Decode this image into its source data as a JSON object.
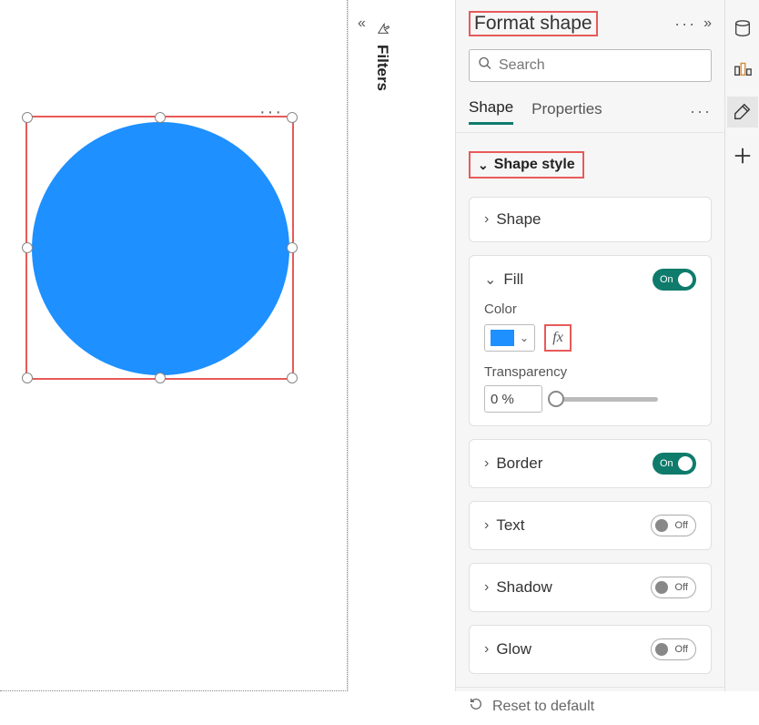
{
  "panel": {
    "title": "Format shape",
    "search_placeholder": "Search"
  },
  "filters": {
    "label": "Filters"
  },
  "tabs": {
    "shape": "Shape",
    "properties": "Properties"
  },
  "shape_style": {
    "label": "Shape style"
  },
  "cards": {
    "shape": "Shape",
    "fill": {
      "label": "Fill",
      "toggle": "On",
      "color_label": "Color",
      "color_value": "#1e90ff",
      "fx_label": "fx",
      "transparency_label": "Transparency",
      "transparency_value": "0 %"
    },
    "border": {
      "label": "Border",
      "toggle": "On"
    },
    "text": {
      "label": "Text",
      "toggle": "Off"
    },
    "shadow": {
      "label": "Shadow",
      "toggle": "Off"
    },
    "glow": {
      "label": "Glow",
      "toggle": "Off"
    }
  },
  "reset": "Reset to default"
}
